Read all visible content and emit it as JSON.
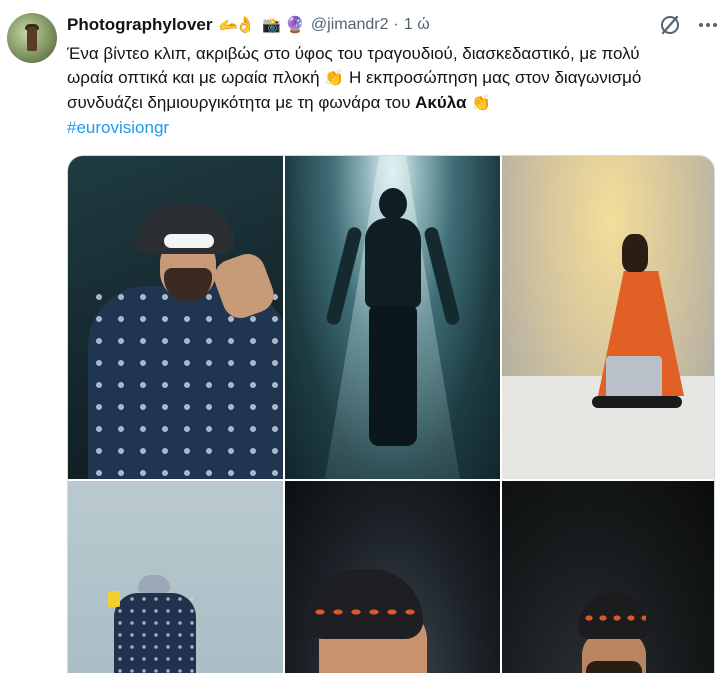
{
  "tweet": {
    "author": {
      "display_name": "Photographylover",
      "name_emojis": [
        "🫴👌",
        "📸",
        "🔮"
      ],
      "handle": "@jimandr2",
      "separator": "·",
      "time": "1 ώ"
    },
    "text": {
      "line1": "Ένα βίντεο κλιπ, ακριβώς στο ύφος του τραγουδιού, διασκεδαστικό, με πολύ",
      "line2_part1": "ωραία οπτικά και με ωραία πλοκή",
      "clap": "👏",
      "line2_part2": "Η εκπροσώπηση μας στον διαγωνισμό",
      "line3_part1": "συνδυάζει δημιουργικότητα με τη φωνάρα του",
      "line3_bold": "Ακύλα",
      "hashtag": "#eurovisiongr"
    },
    "icons": {
      "grok": "grok-icon",
      "more": "more-icon"
    },
    "media": {
      "grid": "3x2",
      "images": [
        "image-bucket-hat-sunglasses",
        "image-figure-in-spotlight",
        "image-orange-coat-instrument",
        "image-dancing-figure",
        "image-smiling-beanie",
        "image-beanie-beard"
      ]
    },
    "colors": {
      "text": "#0f1419",
      "secondary": "#536471",
      "link": "#1d9bf0",
      "border": "#cfd9de"
    }
  }
}
